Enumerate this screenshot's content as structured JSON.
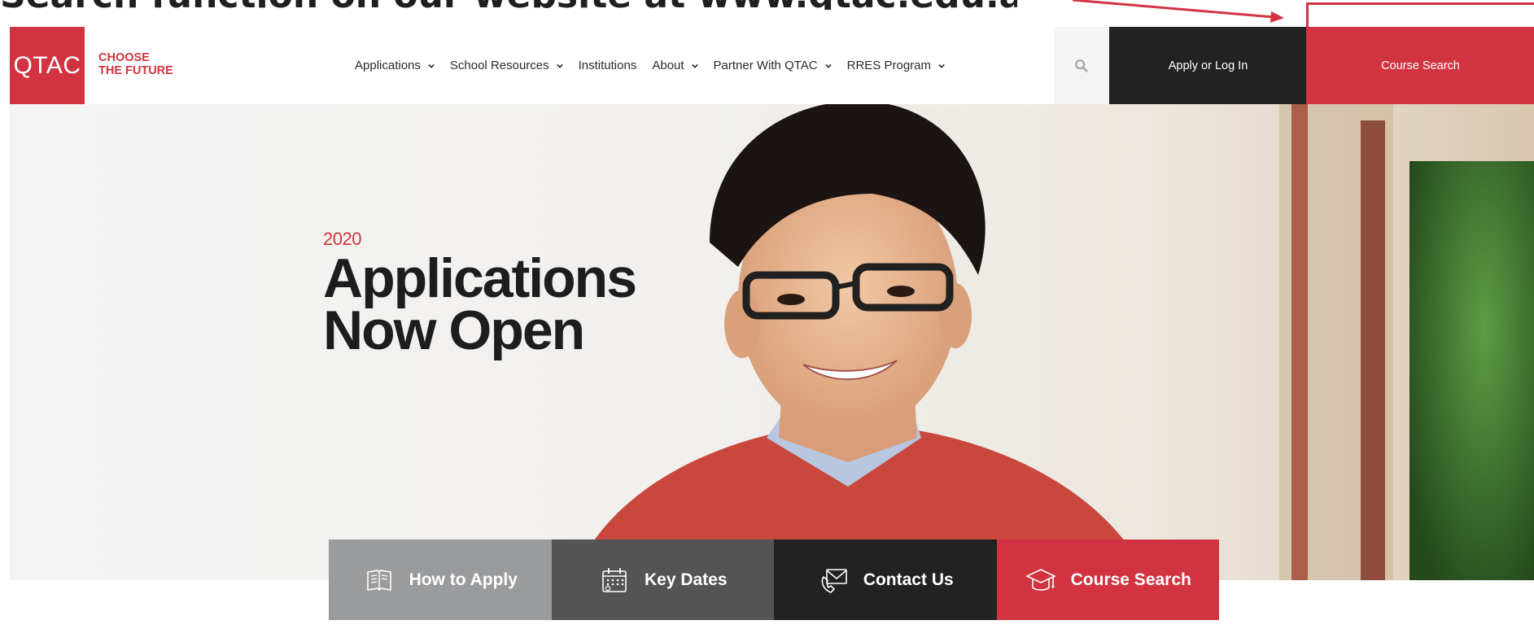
{
  "caption": {
    "text": "Search function on our website at www.qtac.edu.au"
  },
  "colors": {
    "brand_red": "#d13440",
    "dark": "#222222",
    "mid_gray": "#545455",
    "light_gray": "#9a9b9d"
  },
  "header": {
    "logo_text": "QTAC",
    "tagline_line1": "CHOOSE",
    "tagline_line2": "THE FUTURE",
    "nav": [
      {
        "label": "Applications",
        "has_dropdown": true
      },
      {
        "label": "School Resources",
        "has_dropdown": true
      },
      {
        "label": "Institutions",
        "has_dropdown": false
      },
      {
        "label": "About",
        "has_dropdown": true
      },
      {
        "label": "Partner With QTAC",
        "has_dropdown": true
      },
      {
        "label": "RRES Program",
        "has_dropdown": true
      }
    ],
    "search_icon": "search-icon",
    "apply_label": "Apply or Log In",
    "course_search_label": "Course Search"
  },
  "hero": {
    "year": "2020",
    "title_line1": "Applications",
    "title_line2": "Now Open"
  },
  "quick_links": [
    {
      "label": "How to Apply",
      "icon": "book-icon"
    },
    {
      "label": "Key Dates",
      "icon": "calendar-icon"
    },
    {
      "label": "Contact Us",
      "icon": "envelope-icon"
    },
    {
      "label": "Course Search",
      "icon": "graduation-cap-icon"
    }
  ]
}
